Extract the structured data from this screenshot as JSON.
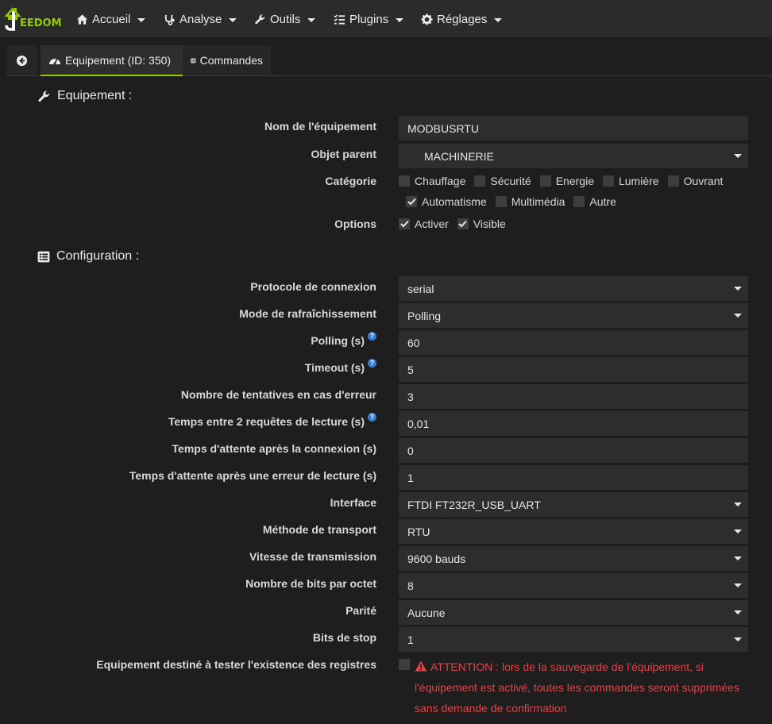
{
  "navbar": {
    "logo_text": "EEDOM",
    "items": [
      {
        "label": "Accueil",
        "icon": "home-icon"
      },
      {
        "label": "Analyse",
        "icon": "stethoscope-icon"
      },
      {
        "label": "Outils",
        "icon": "wrench-icon"
      },
      {
        "label": "Plugins",
        "icon": "tasks-icon"
      },
      {
        "label": "Réglages",
        "icon": "cogs-icon"
      }
    ]
  },
  "tabs": {
    "back_icon": "arrow-circle-left-icon",
    "equipment": "Equipement (ID: 350)",
    "commands": "Commandes"
  },
  "equipement": {
    "title": "Equipement :",
    "name_label": "Nom de l'équipement",
    "name_value": "MODBUSRTU",
    "parent_label": "Objet parent",
    "parent_value": "MACHINERIE",
    "category_label": "Catégorie",
    "categories": [
      {
        "label": "Chauffage",
        "checked": false
      },
      {
        "label": "Sécurité",
        "checked": false
      },
      {
        "label": "Energie",
        "checked": false
      },
      {
        "label": "Lumière",
        "checked": false
      },
      {
        "label": "Ouvrant",
        "checked": false
      },
      {
        "label": "Automatisme",
        "checked": true
      },
      {
        "label": "Multimédia",
        "checked": false
      },
      {
        "label": "Autre",
        "checked": false
      }
    ],
    "options_label": "Options",
    "options": [
      {
        "label": "Activer",
        "checked": true
      },
      {
        "label": "Visible",
        "checked": true
      }
    ]
  },
  "configuration": {
    "title": "Configuration :",
    "protocol_label": "Protocole de connexion",
    "protocol_value": "serial",
    "refresh_label": "Mode de rafraîchissement",
    "refresh_value": "Polling",
    "polling_label": "Polling (s)",
    "polling_value": "60",
    "timeout_label": "Timeout (s)",
    "timeout_value": "5",
    "retries_label": "Nombre de tentatives en cas d'erreur",
    "retries_value": "3",
    "time_between_label": "Temps entre 2 requêtes de lecture (s)",
    "time_between_value": "0,01",
    "wait_conn_label": "Temps d'attente après la connexion (s)",
    "wait_conn_value": "0",
    "wait_err_label": "Temps d'attente après une erreur de lecture (s)",
    "wait_err_value": "1",
    "interface_label": "Interface",
    "interface_value": "FTDI FT232R_USB_UART",
    "transport_label": "Méthode de transport",
    "transport_value": "RTU",
    "speed_label": "Vitesse de transmission",
    "speed_value": "9600 bauds",
    "bits_label": "Nombre de bits par octet",
    "bits_value": "8",
    "parity_label": "Parité",
    "parity_value": "Aucune",
    "stop_label": "Bits de stop",
    "stop_value": "1",
    "test_label": "Equipement destiné à tester l'existence des registres",
    "test_checked": false,
    "warning": "ATTENTION : lors de la sauvegarde de l'équipement, si l'équipement est activé, toutes les commandes seront supprimées sans demande de confirmation"
  },
  "colors": {
    "accent": "#94ca02",
    "warning": "#e04448",
    "help": "#3a7bd5"
  }
}
